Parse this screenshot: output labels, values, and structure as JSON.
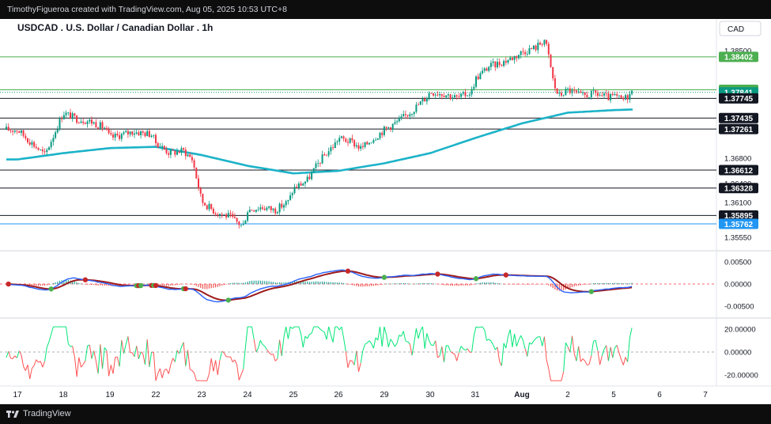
{
  "header": {
    "attribution": "TimothyFigueroa created with TradingView.com, Aug 05, 2025 10:53 UTC+8"
  },
  "footer": {
    "brand": "TradingView"
  },
  "colors": {
    "up": "#089981",
    "down": "#f23645",
    "ma": "#1cb3c8",
    "macd_line": "#2962ff",
    "signal_line": "#ff6d00",
    "rsi_up": "#00e676",
    "rsi_down": "#ff5252",
    "green_level": "#4caf50",
    "blue_level": "#2196f3"
  },
  "chart_data": [
    {
      "type": "candlestick",
      "title": "USDCAD . U.S. Dollar / Canadian Dollar . 1h",
      "currency": "CAD",
      "x_ticks": [
        "17",
        "18",
        "19",
        "22",
        "23",
        "24",
        "25",
        "26",
        "29",
        "30",
        "31",
        "Aug",
        "2",
        "5",
        "6",
        "7"
      ],
      "y_ticks": [
        1.385,
        1.378,
        1.368,
        1.364,
        1.361,
        1.3555
      ],
      "ylim": [
        1.3535,
        1.3895
      ],
      "levels": [
        {
          "value": 1.38402,
          "label": "1.38402",
          "color": "green"
        },
        {
          "value": 1.37881,
          "label": "1.37881",
          "color": "green"
        },
        {
          "value": 1.37841,
          "label": "1.37841",
          "color": "price"
        },
        {
          "value": 1.37745,
          "label": "1.37745",
          "color": "black"
        },
        {
          "value": 1.37435,
          "label": "1.37435",
          "color": "black"
        },
        {
          "value": 1.37261,
          "label": "1.37261",
          "color": "black"
        },
        {
          "value": 1.36612,
          "label": "1.36612",
          "color": "black"
        },
        {
          "value": 1.36328,
          "label": "1.36328",
          "color": "black"
        },
        {
          "value": 1.35895,
          "label": "1.35895",
          "color": "black"
        },
        {
          "value": 1.35762,
          "label": "1.35762",
          "color": "blue"
        }
      ],
      "close_path": [
        [
          "17",
          1.3725
        ],
        [
          "17.3",
          1.3705
        ],
        [
          "17.6",
          1.3685
        ],
        [
          "17.9",
          1.3735
        ],
        [
          "18",
          1.3752
        ],
        [
          "18.3",
          1.3742
        ],
        [
          "18.6",
          1.3738
        ],
        [
          "18.9",
          1.3728
        ],
        [
          "19",
          1.3712
        ],
        [
          "19.5",
          1.3722
        ],
        [
          "19.9",
          1.3718
        ],
        [
          "22",
          1.3705
        ],
        [
          "22.3",
          1.3688
        ],
        [
          "22.6",
          1.3692
        ],
        [
          "22.8",
          1.3678
        ],
        [
          "23",
          1.3612
        ],
        [
          "23.3",
          1.3595
        ],
        [
          "23.6",
          1.3588
        ],
        [
          "23.9",
          1.3572
        ],
        [
          "24",
          1.3598
        ],
        [
          "24.3",
          1.3603
        ],
        [
          "24.6",
          1.3598
        ],
        [
          "24.9",
          1.3612
        ],
        [
          "25",
          1.3632
        ],
        [
          "25.3",
          1.3645
        ],
        [
          "25.6",
          1.3678
        ],
        [
          "25.9",
          1.3702
        ],
        [
          "26",
          1.3712
        ],
        [
          "26.3",
          1.3705
        ],
        [
          "26.5",
          1.3695
        ],
        [
          "26.7",
          1.3708
        ],
        [
          "29",
          1.3725
        ],
        [
          "29.3",
          1.3738
        ],
        [
          "29.6",
          1.3755
        ],
        [
          "29.9",
          1.3775
        ],
        [
          "30",
          1.3785
        ],
        [
          "30.3",
          1.3782
        ],
        [
          "30.6",
          1.3775
        ],
        [
          "30.9",
          1.3785
        ],
        [
          "31",
          1.3805
        ],
        [
          "31.3",
          1.3825
        ],
        [
          "31.6",
          1.3832
        ],
        [
          "31.9",
          1.3842
        ],
        [
          "Aug",
          1.3848
        ],
        [
          "Aug.3",
          1.3855
        ],
        [
          "Aug.5",
          1.3868
        ],
        [
          "Aug.6",
          1.3835
        ],
        [
          "Aug.7",
          1.3795
        ],
        [
          "Aug.8",
          1.3778
        ],
        [
          "2",
          1.3788
        ],
        [
          "2.3",
          1.3778
        ],
        [
          "2.6",
          1.3782
        ],
        [
          "2.9",
          1.3775
        ],
        [
          "5",
          1.3778
        ],
        [
          "5.2",
          1.3772
        ],
        [
          "5.4",
          1.3784
        ]
      ],
      "ma_path": [
        [
          "17",
          1.3678
        ],
        [
          "18",
          1.3688
        ],
        [
          "19",
          1.3696
        ],
        [
          "22",
          1.3698
        ],
        [
          "23",
          1.3685
        ],
        [
          "24",
          1.3668
        ],
        [
          "25",
          1.3656
        ],
        [
          "26",
          1.366
        ],
        [
          "29",
          1.3672
        ],
        [
          "30",
          1.3688
        ],
        [
          "31",
          1.3712
        ],
        [
          "Aug",
          1.3735
        ],
        [
          "2",
          1.3752
        ],
        [
          "5",
          1.3756
        ],
        [
          "5.4",
          1.3757
        ]
      ]
    },
    {
      "type": "macd",
      "y_ticks": [
        0.005,
        0.0,
        -0.005
      ],
      "y_tick_labels": [
        "0.00500",
        "0.00000",
        "-0.00500"
      ]
    },
    {
      "type": "oscillator",
      "y_ticks": [
        20.0,
        0.0,
        -20.0
      ],
      "y_tick_labels": [
        "20.00000",
        "0.00000",
        "-20.00000"
      ]
    }
  ]
}
